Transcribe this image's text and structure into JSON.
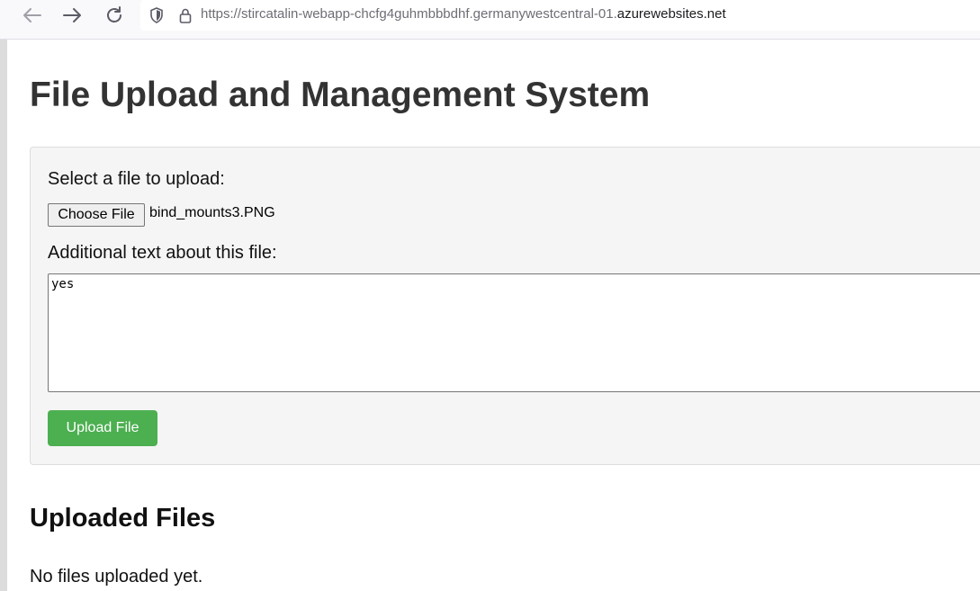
{
  "browser": {
    "url_prefix": "https://stircatalin-webapp-chcfg4guhmbbbdhf.germanywestcentral-01.",
    "url_host": "azurewebsites.net",
    "icons": {
      "back": "arrow-left-icon",
      "forward": "arrow-right-icon",
      "reload": "reload-icon",
      "tracking": "shield-icon",
      "security": "lock-icon"
    }
  },
  "page": {
    "title": "File Upload and Management System",
    "upload_form": {
      "select_label": "Select a file to upload:",
      "choose_button": "Choose File",
      "selected_file": "bind_mounts3.PNG",
      "text_label": "Additional text about this file:",
      "text_value": "yes",
      "upload_button": "Upload File"
    },
    "uploaded_section": {
      "heading": "Uploaded Files",
      "empty_message": "No files uploaded yet."
    }
  },
  "colors": {
    "upload_button": "#4caf50",
    "panel_background": "#f5f5f5",
    "title_text": "#333333"
  }
}
